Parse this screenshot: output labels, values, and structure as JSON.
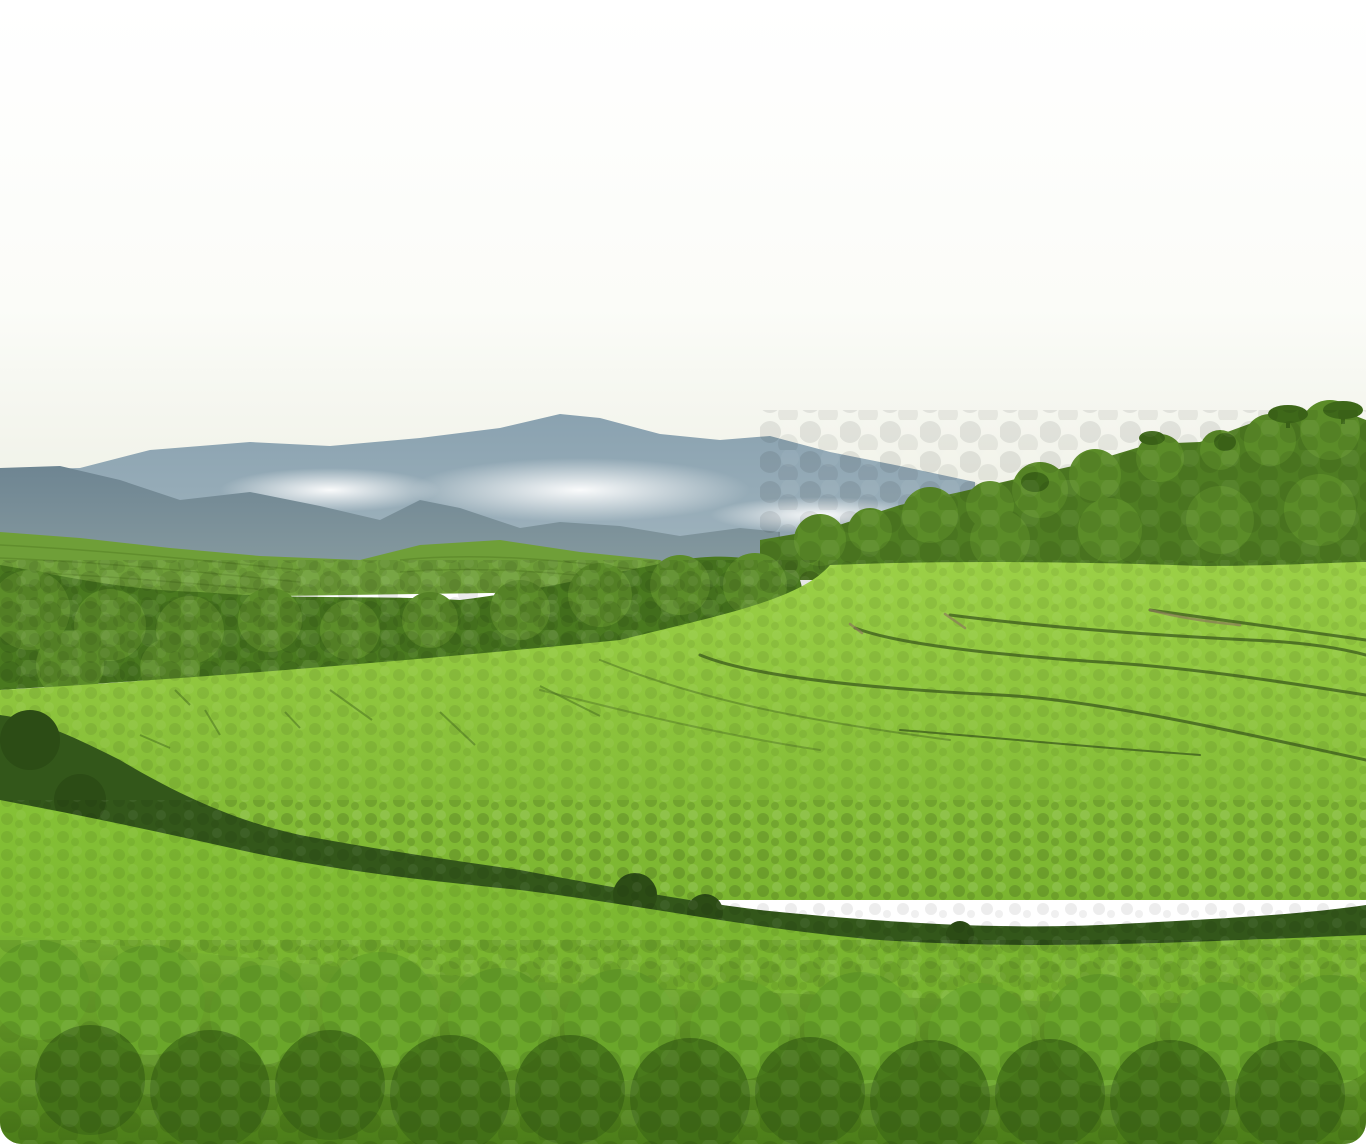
{
  "scene": {
    "description_free": true,
    "colors": {
      "sky_top": "#ffffff",
      "sky_horizon": "#eef0e6",
      "mountain_far": "#7f97a6",
      "mountain_mid": "#6c8290",
      "mist": "#f2f4f2",
      "forest_dark": "#3f6a1e",
      "forest_mid": "#5d8f27",
      "field_light": "#8cc63a",
      "field_mid": "#74b02c",
      "field_dark": "#4f7f1c",
      "furrow": "#3b5a1c",
      "path": "#8a7a5a"
    }
  }
}
